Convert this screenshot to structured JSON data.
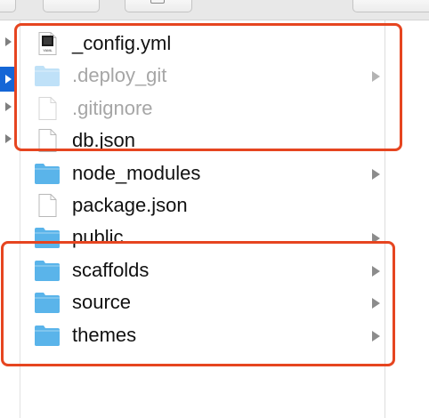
{
  "files": [
    {
      "name": "_config.yml",
      "kind": "yml-file",
      "dim": false,
      "has_children": false
    },
    {
      "name": ".deploy_git",
      "kind": "folder",
      "dim": true,
      "has_children": true
    },
    {
      "name": ".gitignore",
      "kind": "file",
      "dim": true,
      "has_children": false
    },
    {
      "name": "db.json",
      "kind": "file",
      "dim": false,
      "has_children": false
    },
    {
      "name": "node_modules",
      "kind": "folder",
      "dim": false,
      "has_children": true
    },
    {
      "name": "package.json",
      "kind": "file",
      "dim": false,
      "has_children": false
    },
    {
      "name": "public",
      "kind": "folder",
      "dim": false,
      "has_children": true
    },
    {
      "name": "scaffolds",
      "kind": "folder",
      "dim": false,
      "has_children": true
    },
    {
      "name": "source",
      "kind": "folder",
      "dim": false,
      "has_children": true
    },
    {
      "name": "themes",
      "kind": "folder",
      "dim": false,
      "has_children": true
    }
  ],
  "yml_badge": "YAML",
  "colors": {
    "highlight": "#e64520",
    "selection": "#1566d6",
    "folder": "#5ab4ea",
    "folder_dim": "#bfe1f7"
  }
}
